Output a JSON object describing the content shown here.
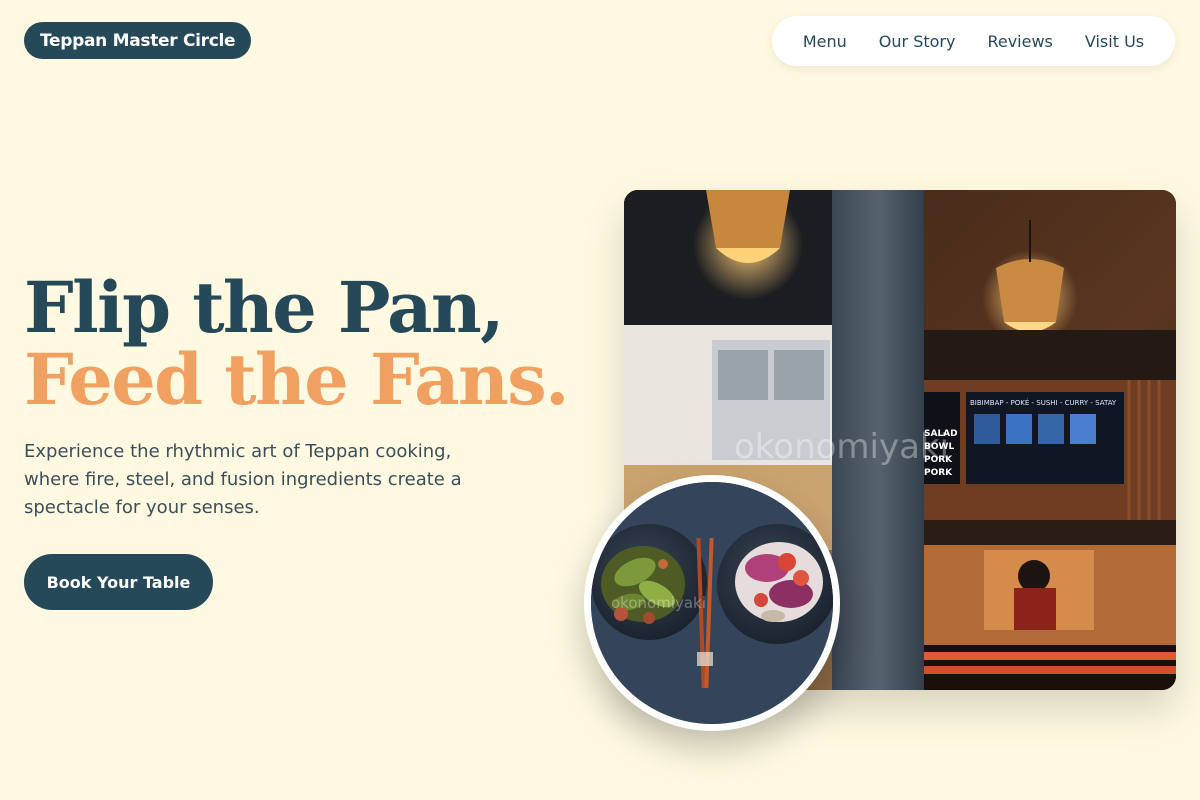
{
  "brand": {
    "name": "Teppan Master Circle"
  },
  "nav": {
    "items": [
      "Menu",
      "Our Story",
      "Reviews",
      "Visit Us"
    ]
  },
  "hero": {
    "line1": "Flip the Pan,",
    "line2": "Feed the Fans.",
    "lead": "Experience the rhythmic art of Teppan cooking, where fire, steel, and fusion ingredients create a spectacle for your senses.",
    "cta": "Book Your Table"
  },
  "images": {
    "main_watermark": "okonomiyaki",
    "round_watermark": "okonomiyaki",
    "menu_board": {
      "header": "BIBIMBAP - POKÉ - SUSHI - CURRY - SATAY",
      "items": [
        "SALAD",
        "BOWL",
        "PORK",
        "PORK"
      ]
    }
  },
  "colors": {
    "background": "#fef9e0",
    "primary": "#26495a",
    "accent": "#f0a061"
  }
}
